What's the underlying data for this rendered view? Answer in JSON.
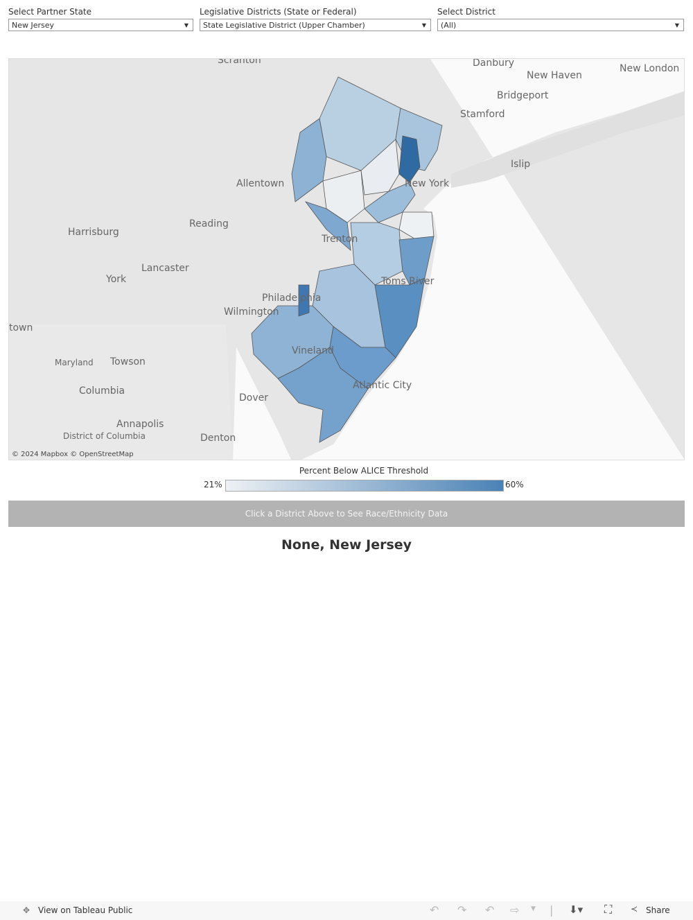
{
  "filters": [
    {
      "label": "Select Partner State",
      "value": "New Jersey"
    },
    {
      "label": "Legislative Districts (State or Federal)",
      "value": "State Legislative District (Upper Chamber)"
    },
    {
      "label": "Select District",
      "value": "(All)"
    }
  ],
  "map": {
    "cities": [
      "Scranton",
      "Danbury",
      "New Haven",
      "New London",
      "Bridgeport",
      "Stamford",
      "Islip",
      "New York",
      "Allentown",
      "Reading",
      "Harrisburg",
      "Trenton",
      "Lancaster",
      "York",
      "Toms River",
      "Philadelphia",
      "Wilmington",
      "Vineland",
      "Atlantic City",
      "Maryland",
      "Towson",
      "Columbia",
      "Dover",
      "Annapolis",
      "District of Columbia",
      "Denton",
      "town"
    ],
    "attribution": "© 2024 Mapbox  © OpenStreetMap",
    "colors": {
      "low": "#eef1f4",
      "high": "#4a82b6"
    }
  },
  "legend": {
    "title": "Percent Below ALICE Threshold",
    "min": "21%",
    "max": "60%"
  },
  "banner": "Click a District Above to See Race/Ethnicity Data",
  "title": "None, New Jersey",
  "footer": {
    "view": "View on Tableau Public",
    "share": "Share",
    "icons": [
      "tableau-logo-icon",
      "undo-icon",
      "redo-icon",
      "revert-icon",
      "refresh-icon",
      "download-icon",
      "fullscreen-icon",
      "share-icon"
    ]
  }
}
